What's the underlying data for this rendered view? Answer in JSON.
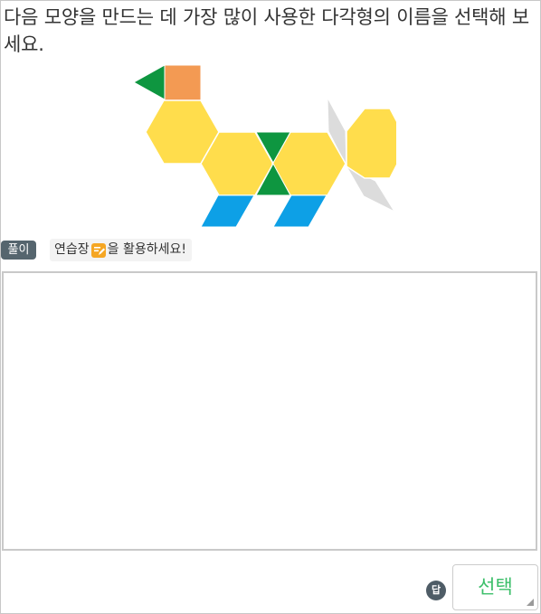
{
  "question": {
    "text": "다음 모양을 만드는 데 가장 많이 사용한 다각형의 이름을 선택해 보세요."
  },
  "solution": {
    "badge_label": "풀이",
    "hint_prefix": "연습장",
    "hint_suffix": "을 활용하세요!",
    "memo_icon": "memo-pencil-icon"
  },
  "answer": {
    "badge_label": "답",
    "select_label": "선택"
  },
  "colors": {
    "hexagon": "#ffdd4c",
    "triangle": "#0e9640",
    "square": "#f39a53",
    "parallelogram_blue": "#0da0e6",
    "rhombus_gray": "#dcdcdc",
    "select_text": "#3cbf6a"
  }
}
